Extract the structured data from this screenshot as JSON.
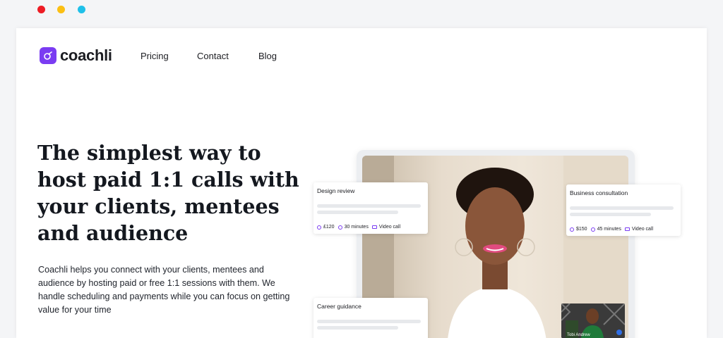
{
  "window": {
    "dots": [
      "#ed1c24",
      "#fbbf13",
      "#1fc0e9"
    ]
  },
  "brand": {
    "name": "coachli",
    "accent": "#7a3cf2"
  },
  "nav": {
    "items": [
      "Pricing",
      "Contact",
      "Blog"
    ]
  },
  "hero": {
    "title": "The simplest way to host paid 1:1 calls with your clients, mentees and audience",
    "description": "Coachli helps you connect with your clients, mentees and audience by hosting paid or free 1:1 sessions with them. We handle scheduling and payments while you can focus on getting value for your time"
  },
  "cards": [
    {
      "title": "Design review",
      "price": "£120",
      "duration": "30 minutes",
      "type": "Video call"
    },
    {
      "title": "Business consultation",
      "price": "$150",
      "duration": "45 minutes",
      "type": "Video call"
    },
    {
      "title": "Career guidance"
    }
  ],
  "pip": {
    "name": "Tobi Andrew"
  }
}
